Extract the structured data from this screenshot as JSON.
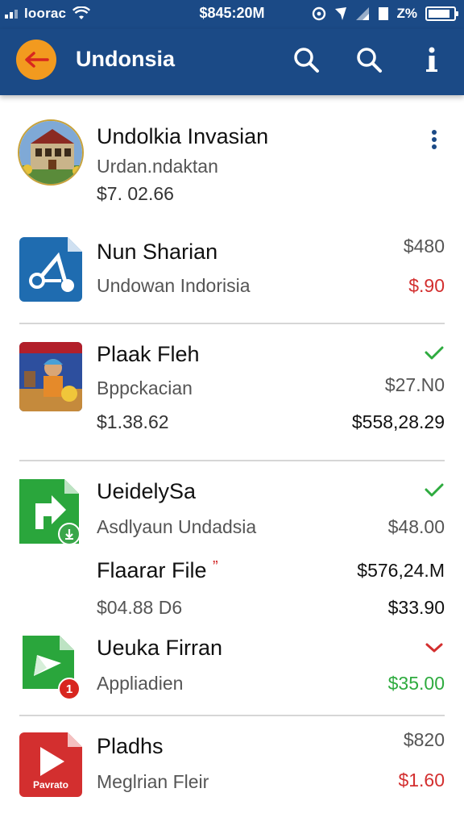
{
  "status_bar": {
    "carrier": "loorac",
    "time": "$845:20M",
    "battery_text": "Z%",
    "battery_level": 0.85
  },
  "app_bar": {
    "title": "Undonsia",
    "icons": [
      "back-arrow-icon",
      "search-icon",
      "search-icon",
      "info-icon"
    ]
  },
  "list": [
    {
      "title": "Undolkia Invasian",
      "subtitle": "Urdan.ndaktan",
      "price": "$7. 02.66",
      "thumb": "building-photo",
      "trailing_icon": "more-vert-icon"
    },
    {
      "title": "Nun Sharian",
      "subtitle": "Undowan Indorisia",
      "right_top": "$480",
      "right_bottom": "$.90",
      "thumb": "share-app-icon",
      "thumb_color": "#1f6cb0"
    },
    {
      "title": "Plaak Fleh",
      "subtitle": "Bppckacian",
      "price": "$1.38.62",
      "right_mid": "$27.N0",
      "right_bottom": "$558,28.29",
      "thumb": "poster-photo",
      "trailing_icon": "check-icon"
    },
    {
      "title": "UeidelySa",
      "subtitle": "Asdlyaun Undadsia",
      "right_mid": "$48.00",
      "thumb": "forward-file-icon",
      "thumb_color": "#2aa63c",
      "trailing_icon": "check-icon",
      "badge": "download-icon"
    },
    {
      "title": "Flaarar File",
      "title_mark": "”",
      "subtitle": "$04.88 D6",
      "right_top": "$576,24.M",
      "right_bottom": "$33.90"
    },
    {
      "title": "Ueuka Firran",
      "subtitle": "Appliadien",
      "right_bottom": "$35.00",
      "thumb": "send-file-icon",
      "thumb_color": "#2aa63c",
      "trailing_icon": "chevron-down-icon",
      "badge_text": "1"
    },
    {
      "title": "Pladhs",
      "subtitle": "Meglrian Fleir",
      "right_top": "$820",
      "right_bottom": "$1.60",
      "thumb": "play-file-icon",
      "thumb_color": "#d32f2f",
      "thumb_label": "Pavrato"
    }
  ],
  "colors": {
    "app_bar": "#1b4a86",
    "back_button": "#f29a1f",
    "price_red": "#d32f2f",
    "price_green": "#2eab3f",
    "check_green": "#2eab3f"
  }
}
